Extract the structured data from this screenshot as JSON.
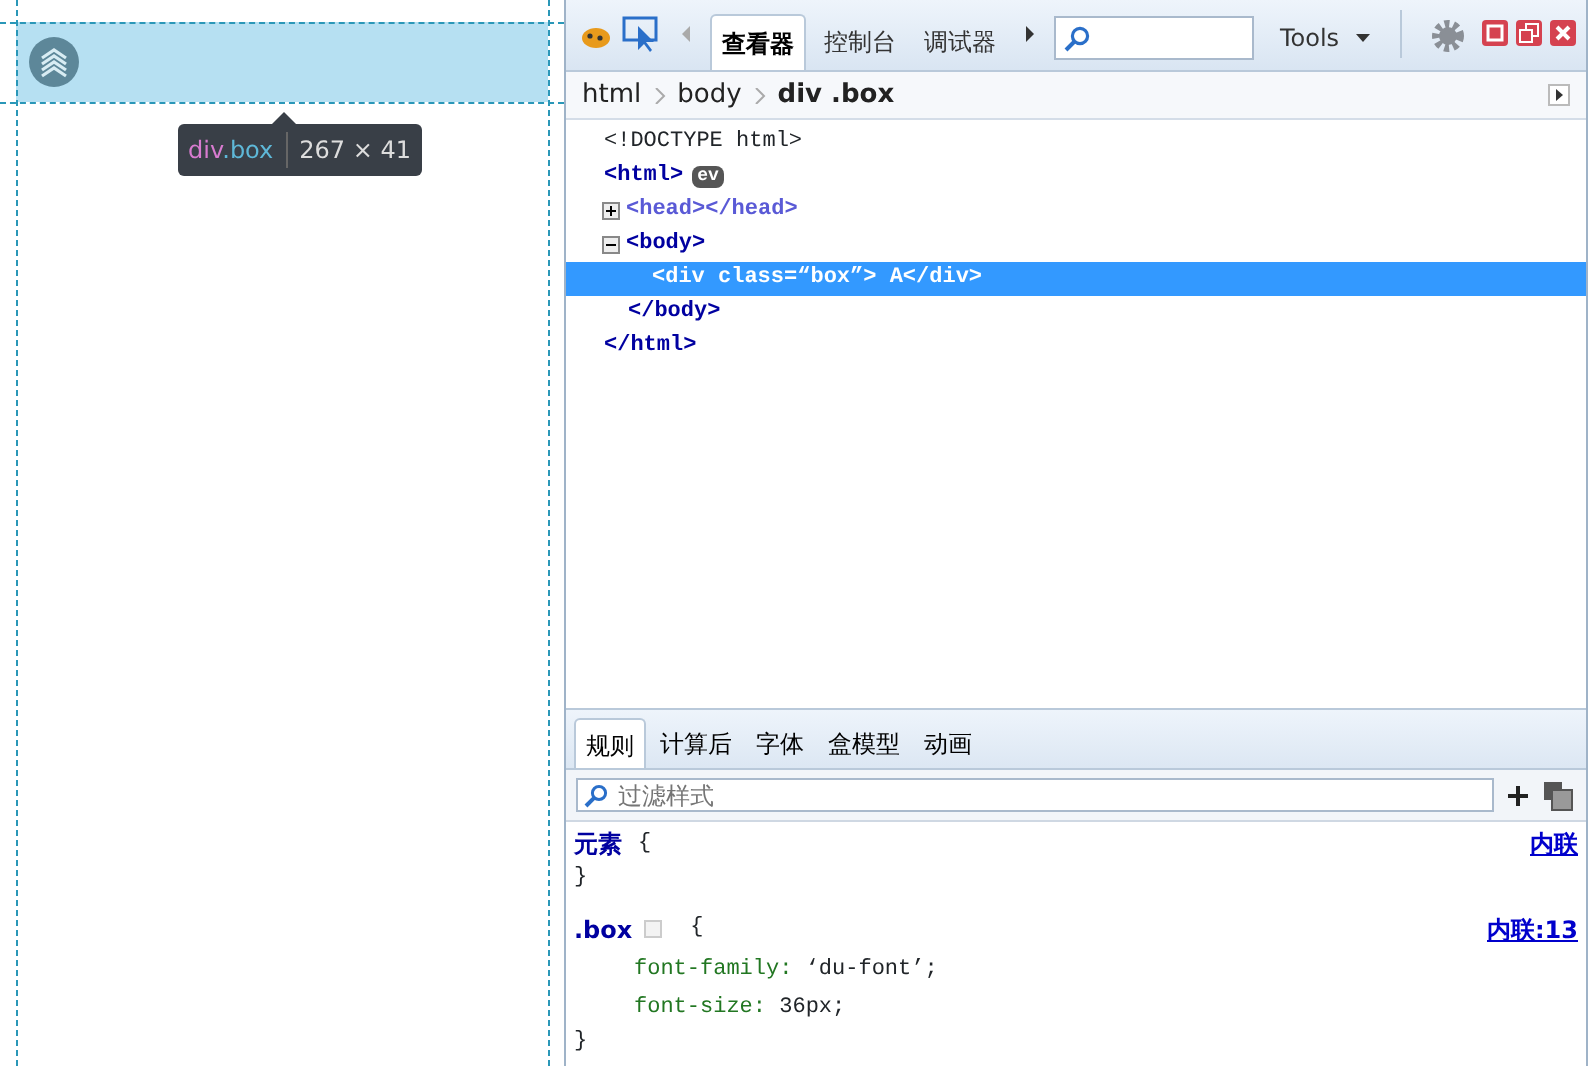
{
  "page": {
    "tooltip": {
      "tag": "div",
      "class_name": ".box",
      "size": "267 × 41"
    }
  },
  "devtools": {
    "tabs": [
      {
        "label": "查看器",
        "selected": true
      },
      {
        "label": "控制台",
        "selected": false
      },
      {
        "label": "调试器",
        "selected": false
      }
    ],
    "tools_menu": "Tools",
    "breadcrumb": [
      {
        "label": "html",
        "selected": false
      },
      {
        "label": "body",
        "selected": false
      },
      {
        "label": "div .box",
        "selected": true
      }
    ],
    "markup": {
      "doctype": "<!DOCTYPE html>",
      "nodes": [
        {
          "open": "<html>",
          "badge": "ev",
          "close": "</html>",
          "selected": false,
          "children": [
            {
              "open": "<head>",
              "close": "</head>",
              "expanded": false,
              "selected": false
            },
            {
              "open": "<body>",
              "close": "</body>",
              "expanded": true,
              "selected": false,
              "children": [
                {
                  "open": "<div class=“box”>",
                  "text": " A",
                  "close": "</div>",
                  "selected": true
                }
              ]
            }
          ]
        }
      ]
    },
    "side_tabs": [
      {
        "label": "规则",
        "selected": true
      },
      {
        "label": "计算后",
        "selected": false
      },
      {
        "label": "字体",
        "selected": false
      },
      {
        "label": "盒模型",
        "selected": false
      },
      {
        "label": "动画",
        "selected": false
      }
    ],
    "filter": {
      "placeholder": "过滤样式"
    },
    "rules": [
      {
        "selector": "元素",
        "open_brace": "{",
        "close_brace": "}",
        "source": "内联"
      },
      {
        "selector": ".box",
        "open_brace": "{",
        "close_brace": "}",
        "source": "内联:13",
        "declarations": [
          {
            "property": "font-family:",
            "value": "‘du-font’;"
          },
          {
            "property": "font-size:",
            "value": "36px;"
          }
        ]
      }
    ]
  }
}
